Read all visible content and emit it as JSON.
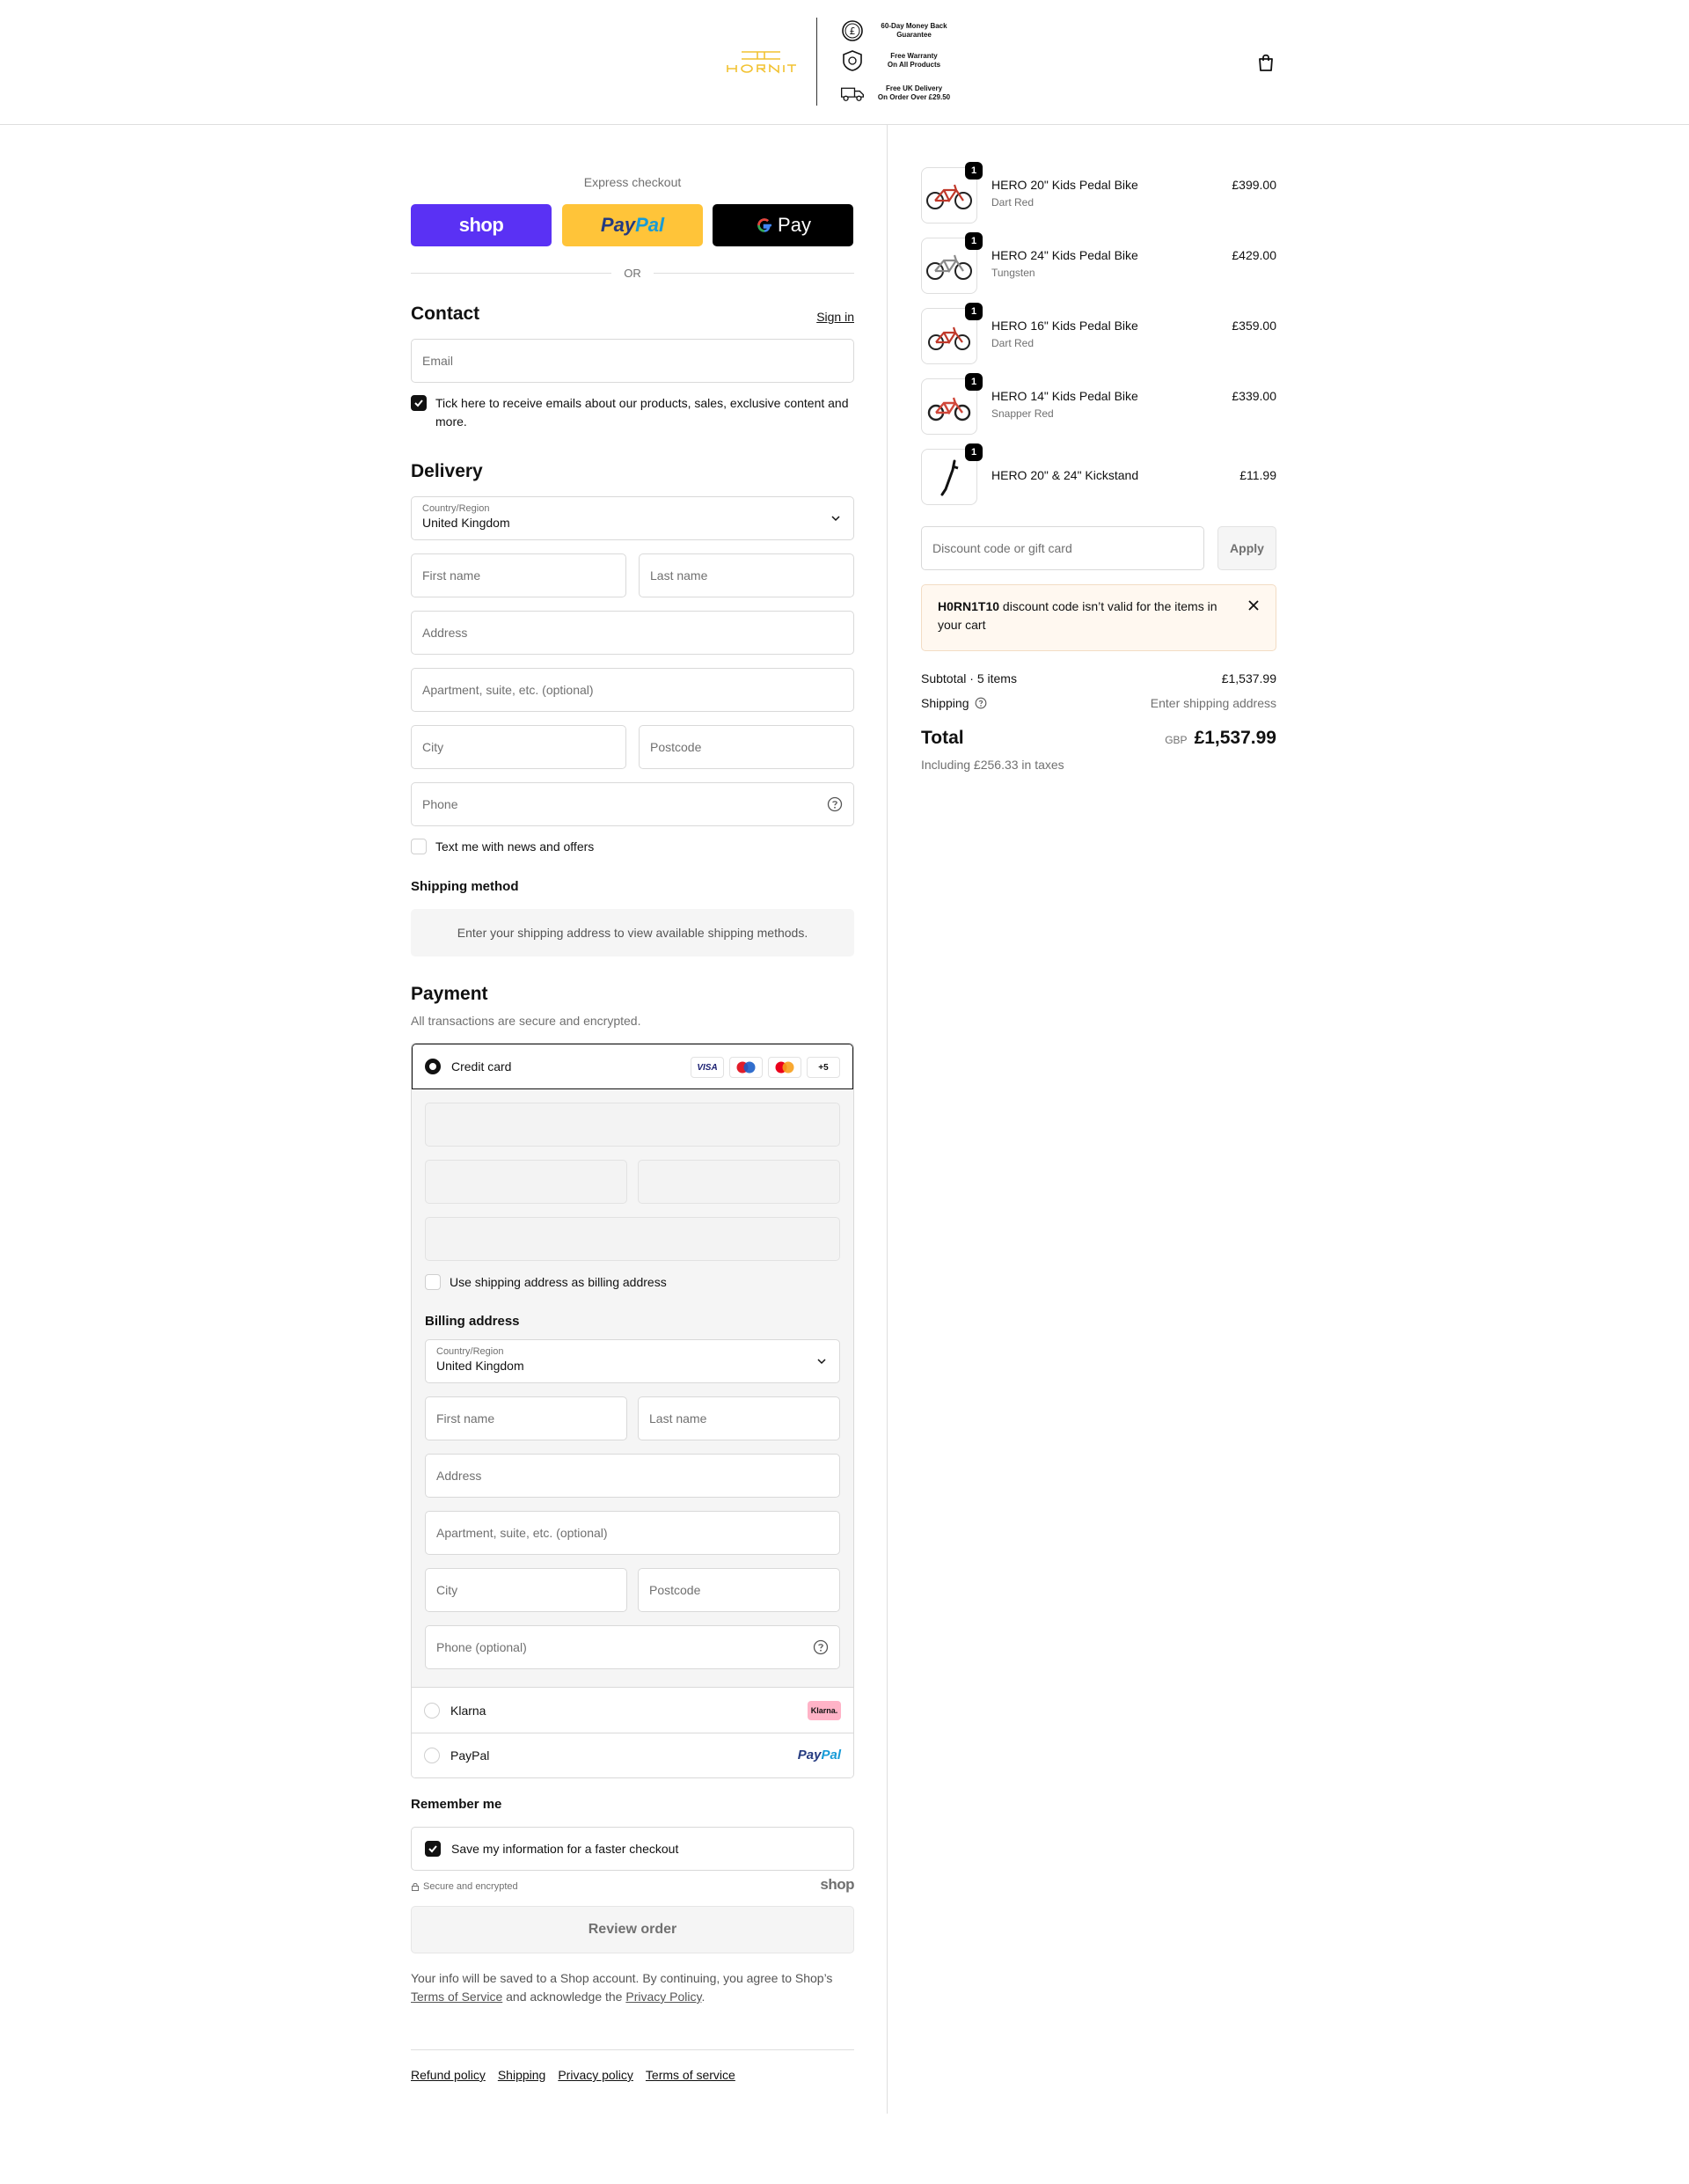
{
  "header": {
    "perks": [
      {
        "line1": "60-Day Money Back",
        "line2": "Guarantee",
        "icon": "pound-coin-icon"
      },
      {
        "line1": "Free Warranty",
        "line2": "On All Products",
        "icon": "shield-icon"
      },
      {
        "line1": "Free UK Delivery",
        "line2": "On Order Over £29.50",
        "icon": "delivery-van-icon"
      }
    ],
    "cart_icon": "shopping-bag-icon",
    "brand_color": "#f2c230"
  },
  "express": {
    "title": "Express checkout",
    "shop_label": "shop",
    "paypal_label_1": "Pay",
    "paypal_label_2": "Pal",
    "gpay_label": "Pay",
    "or_label": "OR"
  },
  "contact": {
    "title": "Contact",
    "sign_in": "Sign in",
    "email_placeholder": "Email",
    "marketing_checkbox": "Tick here to receive emails about our products, sales, exclusive content and more.",
    "marketing_checked": true
  },
  "delivery": {
    "title": "Delivery",
    "country_label": "Country/Region",
    "country_value": "United Kingdom",
    "first_name": "First name",
    "last_name": "Last name",
    "address": "Address",
    "apartment": "Apartment, suite, etc. (optional)",
    "city": "City",
    "postcode": "Postcode",
    "phone": "Phone",
    "sms_checkbox": "Text me with news and offers",
    "sms_checked": false
  },
  "shipping_method": {
    "title": "Shipping method",
    "message": "Enter your shipping address to view available shipping methods."
  },
  "payment": {
    "title": "Payment",
    "subtitle": "All transactions are secure and encrypted.",
    "credit_card_label": "Credit card",
    "card_logos": [
      "VISA",
      "maestro",
      "mastercard",
      "+5"
    ],
    "billing_same_label": "Use shipping address as billing address",
    "billing_same_checked": false,
    "billing_title": "Billing address",
    "billing": {
      "country_label": "Country/Region",
      "country_value": "United Kingdom",
      "first_name": "First name",
      "last_name": "Last name",
      "address": "Address",
      "apartment": "Apartment, suite, etc. (optional)",
      "city": "City",
      "postcode": "Postcode",
      "phone": "Phone (optional)"
    },
    "klarna_label": "Klarna",
    "klarna_badge": "Klarna.",
    "paypal_label": "PayPal",
    "paypal_badge_1": "Pay",
    "paypal_badge_2": "Pal"
  },
  "remember": {
    "title": "Remember me",
    "save_label": "Save my information for a faster checkout",
    "save_checked": true,
    "secure_label": "Secure and encrypted",
    "shop_logo": "shop"
  },
  "review_button": "Review order",
  "terms": {
    "text1": "Your info will be saved to a Shop account. By continuing, you agree to Shop’s",
    "tos_link": "Terms of Service",
    "text2": "and acknowledge the",
    "privacy_link": "Privacy Policy",
    "text3": "."
  },
  "footer_links": [
    "Refund policy",
    "Shipping",
    "Privacy policy",
    "Terms of service"
  ],
  "cart": {
    "items": [
      {
        "name": "HERO 20\" Kids Pedal Bike",
        "variant": "Dart Red",
        "price": "£399.00",
        "qty": "1",
        "color": "#c0392b"
      },
      {
        "name": "HERO 24\" Kids Pedal Bike",
        "variant": "Tungsten",
        "price": "£429.00",
        "qty": "1",
        "color": "#8a8a8a"
      },
      {
        "name": "HERO 16\" Kids Pedal Bike",
        "variant": "Dart Red",
        "price": "£359.00",
        "qty": "1",
        "color": "#c0392b"
      },
      {
        "name": "HERO 14\" Kids Pedal Bike",
        "variant": "Snapper Red",
        "price": "£339.00",
        "qty": "1",
        "color": "#d0473a"
      },
      {
        "name": "HERO 20\" & 24\" Kickstand",
        "variant": "",
        "price": "£11.99",
        "qty": "1",
        "color": "#111111"
      }
    ],
    "discount_placeholder": "Discount code or gift card",
    "apply_label": "Apply",
    "error_code": "H0RN1T10",
    "error_text": "discount code isn’t valid for the items in your cart",
    "subtotal_label": "Subtotal · 5 items",
    "subtotal_value": "£1,537.99",
    "shipping_label": "Shipping",
    "shipping_value": "Enter shipping address",
    "total_label": "Total",
    "currency": "GBP",
    "total_value": "£1,537.99",
    "tax_note": "Including £256.33 in taxes"
  }
}
